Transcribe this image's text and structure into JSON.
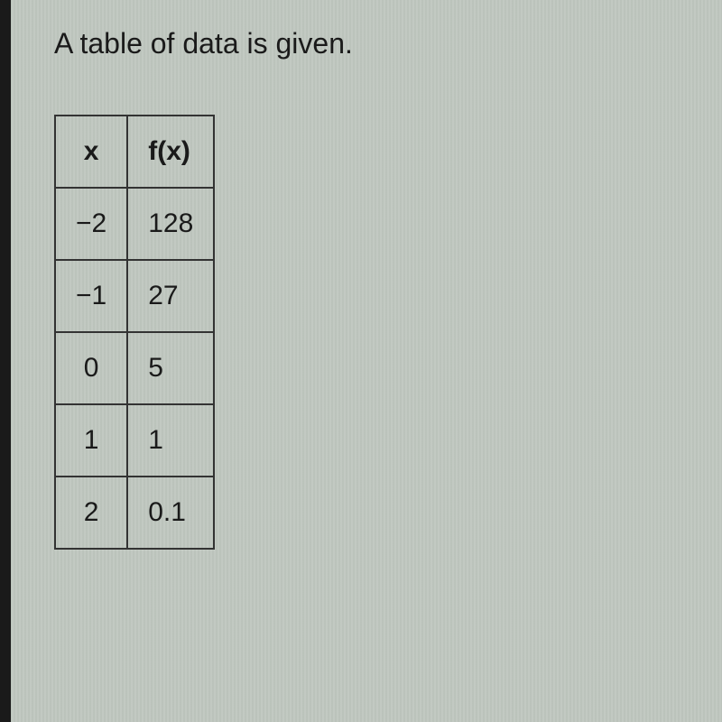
{
  "prompt": "A table of data is given.",
  "table": {
    "headers": {
      "x": "x",
      "fx": "f(x)"
    },
    "rows": [
      {
        "x": "−2",
        "fx": "128"
      },
      {
        "x": "−1",
        "fx": "27"
      },
      {
        "x": "0",
        "fx": "5"
      },
      {
        "x": "1",
        "fx": "1"
      },
      {
        "x": "2",
        "fx": "0.1"
      }
    ]
  },
  "chart_data": {
    "type": "table",
    "title": "A table of data is given.",
    "columns": [
      "x",
      "f(x)"
    ],
    "x": [
      -2,
      -1,
      0,
      1,
      2
    ],
    "values": [
      128,
      27,
      5,
      1,
      0.1
    ]
  }
}
